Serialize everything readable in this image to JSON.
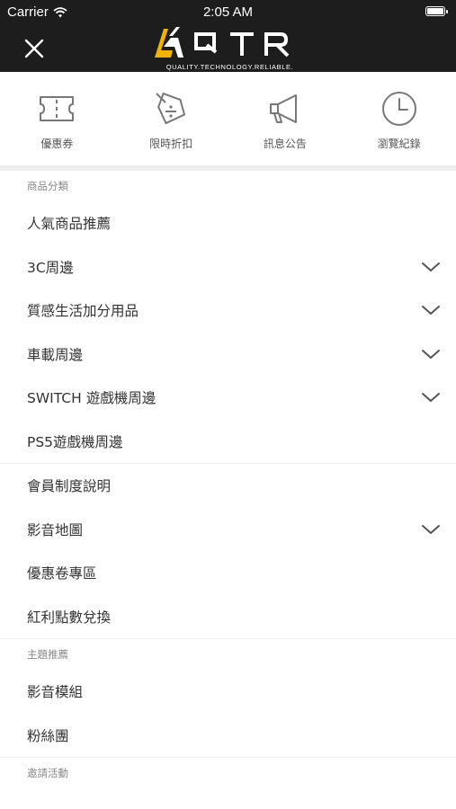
{
  "status_bar": {
    "carrier": "Carrier",
    "time": "2:05 AM"
  },
  "header": {
    "logo_text": "QTR",
    "tagline": "QUALITY.TECHNOLOGY.RELIABLE.",
    "close_icon": "close-icon"
  },
  "quick_links": [
    {
      "label": "優惠券",
      "icon": "ticket-icon"
    },
    {
      "label": "限時折扣",
      "icon": "discount-tag-icon"
    },
    {
      "label": "訊息公告",
      "icon": "megaphone-icon"
    },
    {
      "label": "瀏覽紀錄",
      "icon": "clock-icon"
    }
  ],
  "menu": {
    "category_header": "商品分類",
    "categories": [
      {
        "label": "人氣商品推薦",
        "has_children": false
      },
      {
        "label": "3C周邊",
        "has_children": true
      },
      {
        "label": "質感生活加分用品",
        "has_children": true
      },
      {
        "label": "車載周邊",
        "has_children": true
      },
      {
        "label": "SWITCH 遊戲機周邊",
        "has_children": true
      },
      {
        "label": "PS5遊戲機周邊",
        "has_children": false
      }
    ],
    "links": [
      {
        "label": "會員制度說明",
        "has_children": false
      },
      {
        "label": "影音地圖",
        "has_children": true
      },
      {
        "label": "優惠卷專區",
        "has_children": false
      },
      {
        "label": "紅利點數兌換",
        "has_children": false
      }
    ],
    "theme_header": "主題推薦",
    "themes": [
      {
        "label": "影音模組"
      },
      {
        "label": "粉絲團"
      }
    ],
    "invite_header": "邀請活動"
  },
  "colors": {
    "header_bg": "#1d1d1d",
    "accent": "#f0b400",
    "divider": "#eeeeee"
  }
}
